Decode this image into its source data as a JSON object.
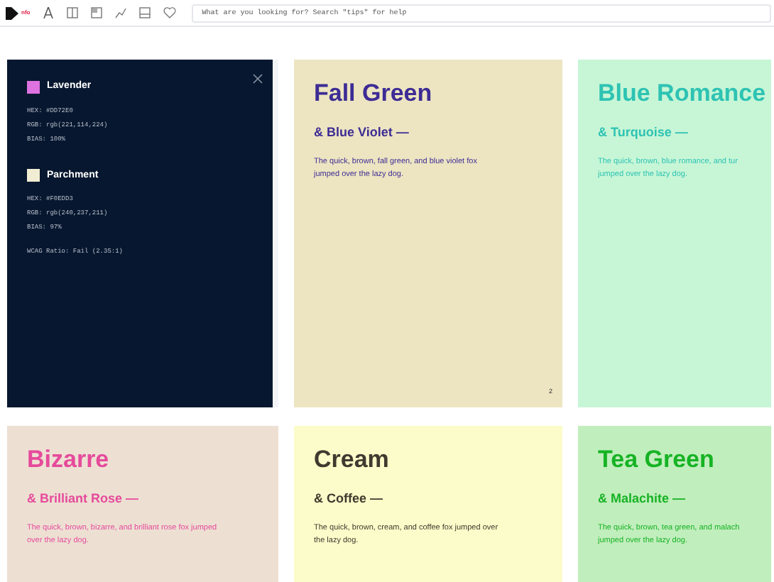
{
  "toolbar": {
    "logo_text": "nfo",
    "search": {
      "placeholder": "What are you looking for? Search \"tips\" for help"
    }
  },
  "info_panel": {
    "colors": [
      {
        "name": "Lavender",
        "color": "#dd72e0",
        "lines": [
          "HEX: #DD72E0",
          "RGB: rgb(221,114,224)",
          "BIAS: 100%"
        ]
      },
      {
        "name": "Parchment",
        "color": "#f0edd3",
        "lines": [
          "HEX: #F0EDD3",
          "RGB: rgb(240,237,211)",
          "BIAS: 97%"
        ]
      }
    ],
    "ratio": "WCAG Ratio: Fail (2.35:1)"
  },
  "cards": [
    {
      "title": "Fall Green",
      "subtitle": "& Blue Violet —",
      "body": "The quick, brown, fall green, and blue violet fox\njumped over the lazy dog.",
      "page": "2",
      "accent": {
        "color": "#3d2c95"
      },
      "color": "#ede5c1"
    },
    {
      "title": "Blue Romance",
      "subtitle": "& Turquoise —",
      "body": "The quick, brown, blue romance, and tur\njumped over the lazy dog.",
      "accent": {
        "color": "#2ec3b3"
      },
      "color": "#c7f6d6"
    },
    {
      "title": "Bizarre",
      "subtitle": "& Brilliant Rose —",
      "body": "The quick, brown, bizarre, and brilliant rose fox jumped\nover the lazy dog.",
      "accent": {
        "color": "#e64a9b"
      },
      "color": "#ede0d3"
    },
    {
      "title": "Cream",
      "subtitle": "& Coffee —",
      "body": "The quick, brown, cream, and coffee fox jumped over\nthe lazy dog.",
      "accent": {
        "color": "#40392f"
      },
      "color": "#fbfcc9"
    },
    {
      "title": "Tea Green",
      "subtitle": "& Malachite —",
      "body": "The quick, brown, tea green, and malach\njumped over the lazy dog.",
      "accent": {
        "color": "#16b324"
      },
      "color": "#c1eebd"
    }
  ]
}
